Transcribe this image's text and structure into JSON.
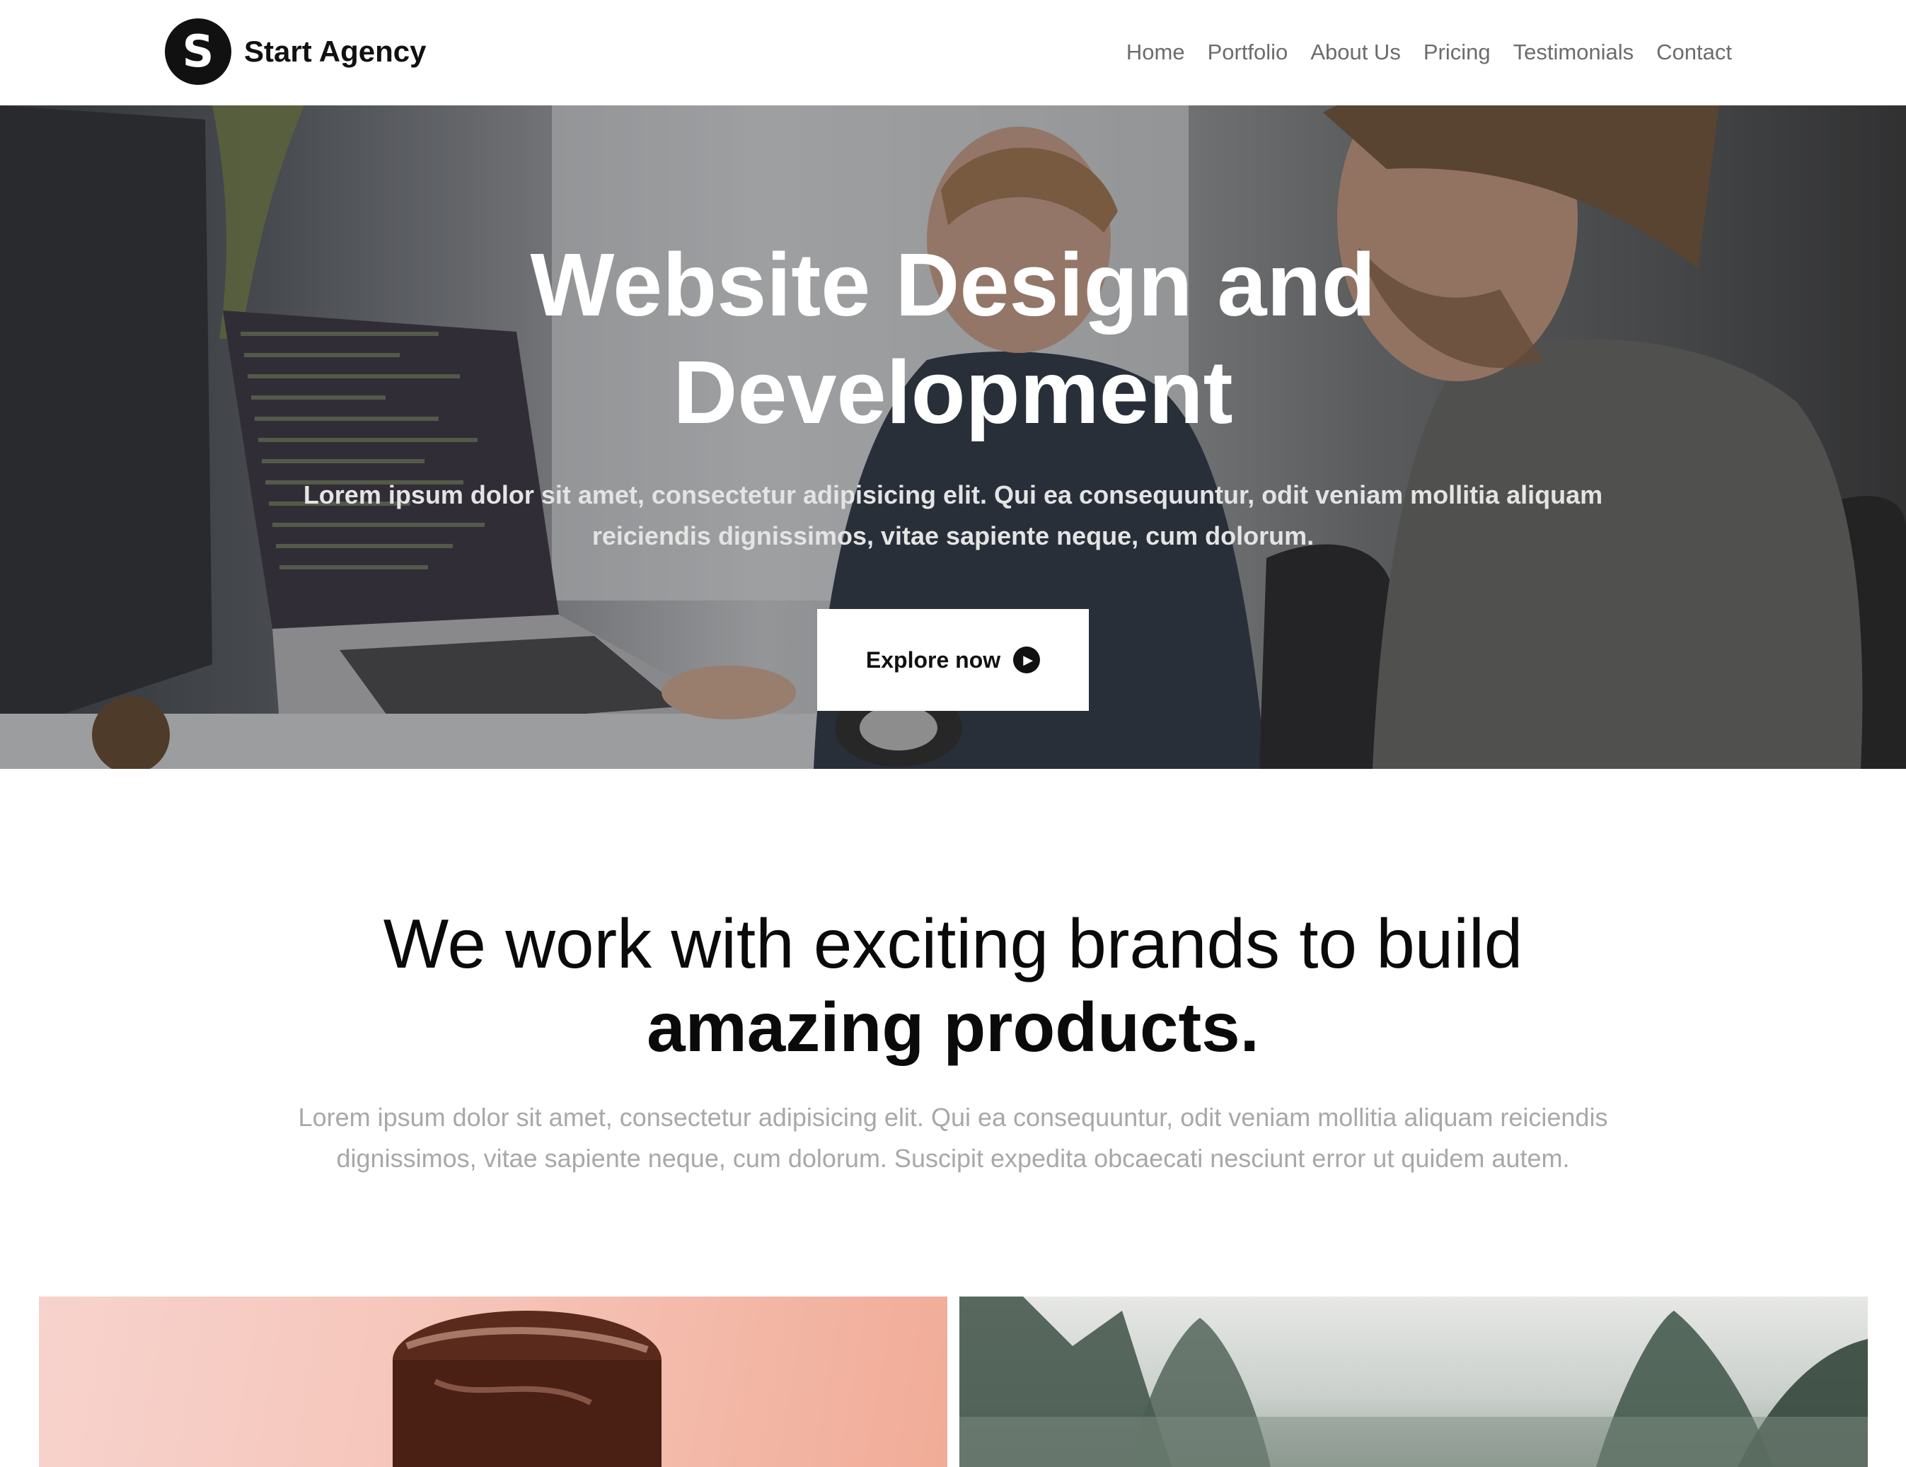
{
  "brand": {
    "logo_letter": "S",
    "name": "Start Agency"
  },
  "nav": {
    "items": [
      {
        "label": "Home"
      },
      {
        "label": "Portfolio"
      },
      {
        "label": "About Us"
      },
      {
        "label": "Pricing"
      },
      {
        "label": "Testimonials"
      },
      {
        "label": "Contact"
      }
    ]
  },
  "hero": {
    "title": "Website Design and Development",
    "text": "Lorem ipsum dolor sit amet, consectetur adipisicing elit. Qui ea consequuntur, odit veniam mollitia aliquam reiciendis dignissimos, vitae sapiente neque, cum dolorum.",
    "button_label": "Explore now",
    "button_icon": "play-circle-icon"
  },
  "intro": {
    "heading_regular": "We work with exciting brands to build",
    "heading_bold": "amazing products.",
    "text": "Lorem ipsum dolor sit amet, consectetur adipisicing elit. Qui ea consequuntur, odit veniam mollitia aliquam reiciendis dignissimos, vitae sapiente neque, cum dolorum. Suscipit expedita obcaecati nesciunt error ut quidem autem."
  },
  "colors": {
    "text_dark": "#111111",
    "nav_link": "#6c6c6c",
    "muted_text": "#a8a8a8",
    "button_bg": "#ffffff"
  }
}
